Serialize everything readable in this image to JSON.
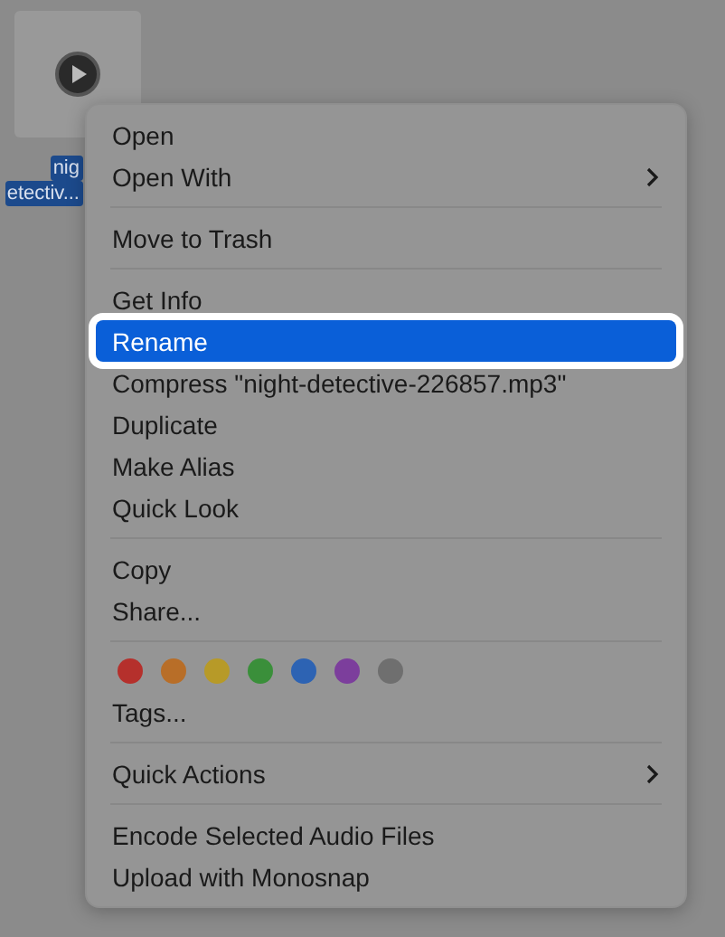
{
  "file": {
    "name_lines": [
      "nig",
      "etectiv..."
    ],
    "selected": true
  },
  "menu": {
    "sections": [
      {
        "kind": "items",
        "items": [
          {
            "label": "Open",
            "submenu": false,
            "selected": false
          },
          {
            "label": "Open With",
            "submenu": true,
            "selected": false
          }
        ]
      },
      {
        "kind": "items",
        "items": [
          {
            "label": "Move to Trash",
            "submenu": false,
            "selected": false
          }
        ]
      },
      {
        "kind": "items",
        "items": [
          {
            "label": "Get Info",
            "submenu": false,
            "selected": false
          },
          {
            "label": "Rename",
            "submenu": false,
            "selected": true
          },
          {
            "label": "Compress \"night-detective-226857.mp3\"",
            "submenu": false,
            "selected": false
          },
          {
            "label": "Duplicate",
            "submenu": false,
            "selected": false
          },
          {
            "label": "Make Alias",
            "submenu": false,
            "selected": false
          },
          {
            "label": "Quick Look",
            "submenu": false,
            "selected": false
          }
        ]
      },
      {
        "kind": "items",
        "items": [
          {
            "label": "Copy",
            "submenu": false,
            "selected": false
          },
          {
            "label": "Share...",
            "submenu": false,
            "selected": false
          }
        ]
      },
      {
        "kind": "tags",
        "tags": [
          {
            "color": "#b5302c"
          },
          {
            "color": "#b86e28"
          },
          {
            "color": "#b79a28"
          },
          {
            "color": "#3a8f3a"
          },
          {
            "color": "#2d63b3"
          },
          {
            "color": "#7c3e9c"
          },
          {
            "color": "#6f6f6f"
          }
        ],
        "items": [
          {
            "label": "Tags...",
            "submenu": false,
            "selected": false
          }
        ]
      },
      {
        "kind": "items",
        "items": [
          {
            "label": "Quick Actions",
            "submenu": true,
            "selected": false
          }
        ]
      },
      {
        "kind": "items",
        "items": [
          {
            "label": "Encode Selected Audio Files",
            "submenu": false,
            "selected": false
          },
          {
            "label": "Upload with Monosnap",
            "submenu": false,
            "selected": false
          }
        ]
      }
    ]
  }
}
